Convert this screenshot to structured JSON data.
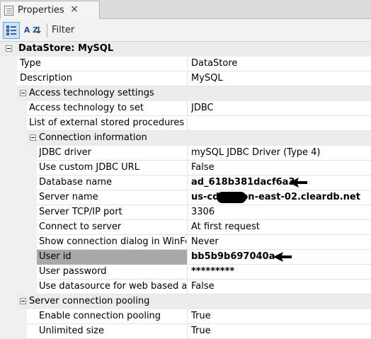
{
  "tab": {
    "label": "Properties",
    "close": "×",
    "icon": "properties-sheet-icon"
  },
  "toolbar": {
    "categorized_icon": "categorized-icon",
    "sort_icon": "sort-az-icon",
    "sort_az": "A Z",
    "sort_arrow": "↓",
    "filter_label": "Filter"
  },
  "grid": {
    "root": {
      "label": "DataStore: MySQL",
      "toggle": "−"
    },
    "type": {
      "name": "Type",
      "value": "DataStore"
    },
    "description": {
      "name": "Description",
      "value": "MySQL"
    },
    "access_category": {
      "label": "Access technology settings",
      "toggle": "−"
    },
    "access_tech": {
      "name": "Access technology to set",
      "value": "JDBC"
    },
    "external_procs": {
      "name": "List of external stored procedures",
      "value": ""
    },
    "connection_category": {
      "label": "Connection information",
      "toggle": "−"
    },
    "jdbc_driver": {
      "name": "JDBC driver",
      "value": "mySQL JDBC Driver (Type 4)"
    },
    "custom_url": {
      "name": "Use custom JDBC URL",
      "value": "False"
    },
    "database_name": {
      "name": "Database name",
      "value": "ad_618b381dacf6a3"
    },
    "server_name": {
      "name": "Server name",
      "value": "us-cdbr-iron-east-02.cleardb.net"
    },
    "port": {
      "name": "Server TCP/IP port",
      "value": "3306"
    },
    "connect": {
      "name": "Connect to server",
      "value": "At first request"
    },
    "show_dialog": {
      "name": "Show connection dialog in WinForms",
      "value": "Never"
    },
    "user_id": {
      "name": "User id",
      "value": "bb5b9b697040a"
    },
    "password": {
      "name": "User password",
      "value": "*********"
    },
    "web_datasource": {
      "name": "Use datasource for web based applications",
      "value": "False"
    },
    "pooling_category": {
      "label": "Server connection pooling",
      "toggle": "−"
    },
    "enable_pooling": {
      "name": "Enable connection pooling",
      "value": "True"
    },
    "unlimited": {
      "name": "Unlimited size",
      "value": "True"
    }
  },
  "colors": {
    "category_bg": "#ececec",
    "selected_bg": "#a8a8a8",
    "accent": "#3a5f9c"
  }
}
